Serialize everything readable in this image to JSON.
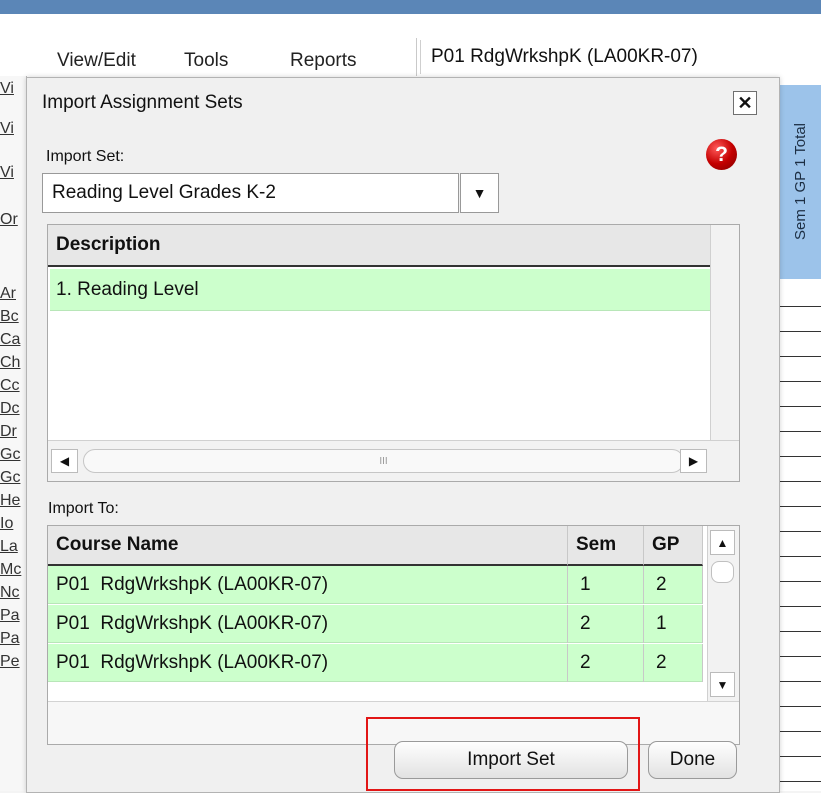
{
  "menu": {
    "view_edit": "View/Edit",
    "tools": "Tools",
    "reports": "Reports"
  },
  "class_selector": {
    "value": "P01  RdgWrkshpK (LA00KR-07)"
  },
  "background": {
    "left_fragments": [
      "Vi",
      "Vi",
      "Vi",
      "Or",
      "Ar",
      "Bc",
      "Ca",
      "Ch",
      "Cc",
      "Dc",
      "Dr",
      "Gc",
      "Gc",
      "He",
      "Io",
      "La",
      "Mc",
      "Nc",
      "Pa",
      "Pa",
      "Pe"
    ],
    "right_header": "Sem 1 GP 1 Total"
  },
  "dialog": {
    "title": "Import Assignment Sets",
    "import_set_label": "Import Set:",
    "selected_set": "Reading Level Grades K-2",
    "description_header": "Description",
    "description_rows": [
      "1. Reading Level"
    ],
    "hscroll_grip": "III",
    "import_to_label": "Import To:",
    "table_headers": {
      "course": "Course Name",
      "sem": "Sem",
      "gp": "GP"
    },
    "table_rows": [
      {
        "course": "P01  RdgWrkshpK (LA00KR-07)",
        "sem": "1",
        "gp": "2"
      },
      {
        "course": "P01  RdgWrkshpK (LA00KR-07)",
        "sem": "2",
        "gp": "1"
      },
      {
        "course": "P01  RdgWrkshpK (LA00KR-07)",
        "sem": "2",
        "gp": "2"
      }
    ],
    "buttons": {
      "import_set": "Import Set",
      "done": "Done"
    }
  },
  "icons": {
    "close": "close-icon",
    "help": "help-icon",
    "dropdown": "chevron-down-icon",
    "scroll_left": "chevron-left-icon",
    "scroll_right": "chevron-right-icon",
    "scroll_up": "chevron-up-icon",
    "scroll_down": "chevron-down-icon"
  },
  "colors": {
    "accent": "#5b86b7",
    "selected_row": "#ccffcc",
    "header_blue": "#9cc3ea",
    "highlight_red": "#e21616"
  }
}
